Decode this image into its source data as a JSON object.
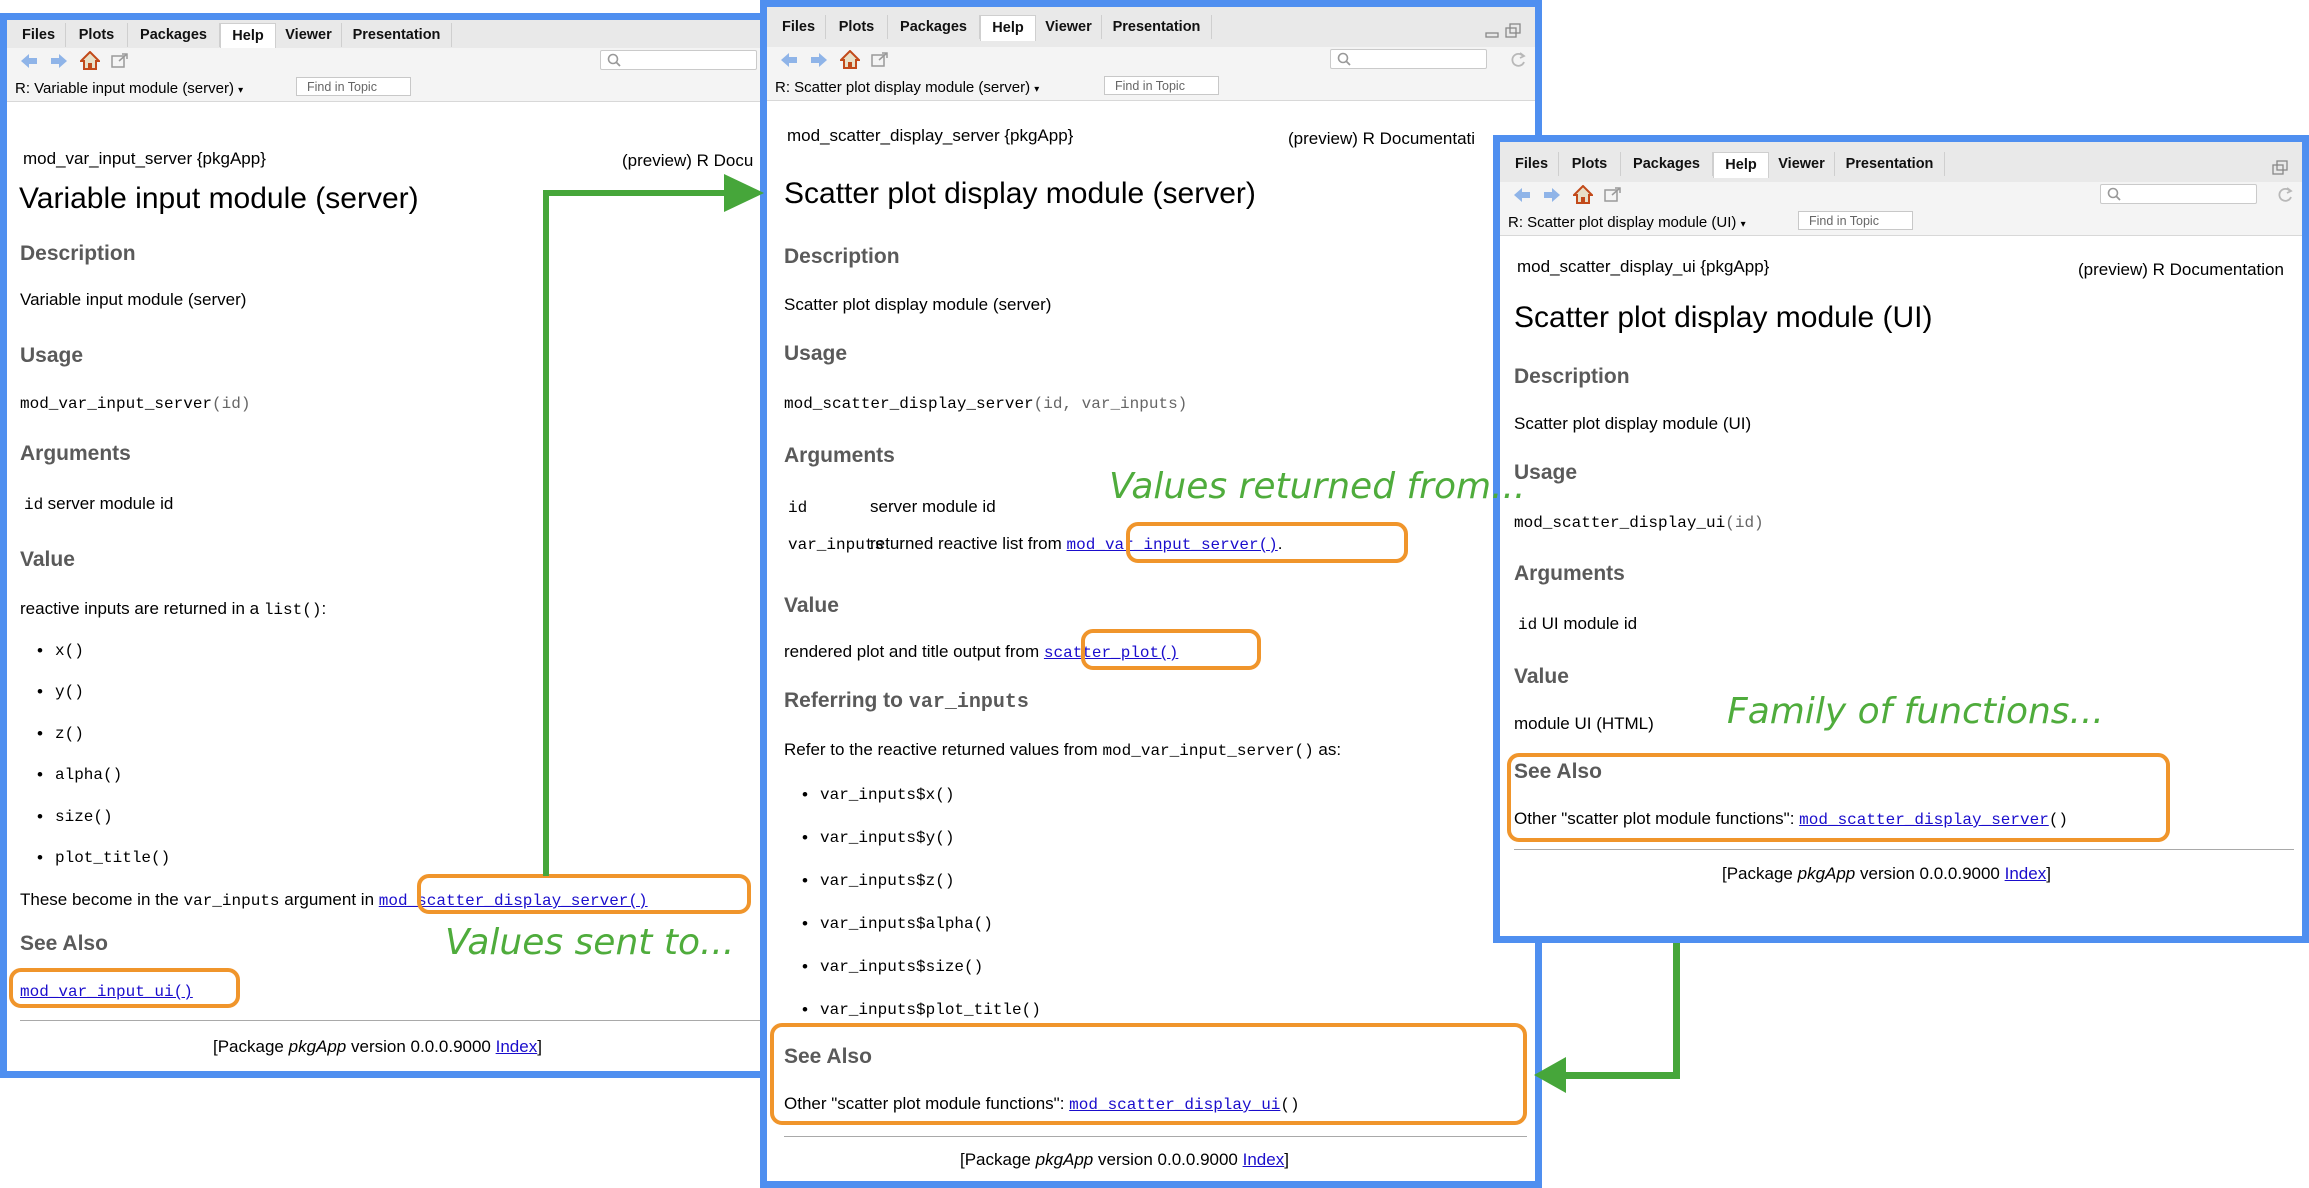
{
  "tabs": {
    "files": "Files",
    "plots": "Plots",
    "packages": "Packages",
    "help": "Help",
    "viewer": "Viewer",
    "presentation": "Presentation"
  },
  "find_placeholder": "Find in Topic",
  "windows": {
    "w1": {
      "address": "R: Variable input module (server)",
      "pkg_line": "mod_var_input_server {pkgApp}",
      "doc_type": "(preview) R Docu",
      "title": "Variable input module (server)",
      "description_heading": "Description",
      "description": "Variable input module (server)",
      "usage_heading": "Usage",
      "usage_fn": "mod_var_input_server",
      "usage_args": "(id)",
      "arguments_heading": "Arguments",
      "arg_name": "id",
      "arg_desc": "server module id",
      "value_heading": "Value",
      "value_text": "reactive inputs are returned in a",
      "value_code": "list()",
      "value_colon": ":",
      "items": [
        "x()",
        "y()",
        "z()",
        "alpha()",
        "size()",
        "plot_title()"
      ],
      "become_text": "These become in the",
      "become_code": "var_inputs",
      "become_text2": "argument in",
      "become_link": "mod_scatter_display_server()",
      "see_also_heading": "See Also",
      "see_also_link": "mod_var_input_ui()",
      "footer_pre": "[Package ",
      "footer_pkg": "pkgApp",
      "footer_ver": " version 0.0.0.9000 ",
      "footer_index": "Index",
      "footer_post": "]"
    },
    "w2": {
      "address": "R: Scatter plot display module (server)",
      "pkg_line": "mod_scatter_display_server {pkgApp}",
      "doc_type": "(preview) R Documentati",
      "title": "Scatter plot display module (server)",
      "description_heading": "Description",
      "description": "Scatter plot display module (server)",
      "usage_heading": "Usage",
      "usage_fn": "mod_scatter_display_server",
      "usage_args": "(id, var_inputs)",
      "arguments_heading": "Arguments",
      "arg1_name": "id",
      "arg1_desc": "server module id",
      "arg2_name": "var_inputs",
      "arg2_desc": "returned reactive list from",
      "arg2_link": "mod_var_input_server()",
      "arg2_post": ".",
      "value_heading": "Value",
      "value_text": "rendered plot and title output from",
      "value_link": "scatter_plot()",
      "referring_heading": "Referring to",
      "referring_code": "var_inputs",
      "refer_text": "Refer to the reactive returned values from",
      "refer_code": "mod_var_input_server()",
      "refer_as": "as:",
      "items": [
        "var_inputs$x()",
        "var_inputs$y()",
        "var_inputs$z()",
        "var_inputs$alpha()",
        "var_inputs$size()",
        "var_inputs$plot_title()"
      ],
      "see_also_heading": "See Also",
      "see_also_text": "Other \"scatter plot module functions\":",
      "see_also_link": "mod_scatter_display_ui",
      "see_also_parens": "()",
      "footer_pre": "[Package ",
      "footer_pkg": "pkgApp",
      "footer_ver": " version 0.0.0.9000 ",
      "footer_index": "Index",
      "footer_post": "]"
    },
    "w3": {
      "address": "R: Scatter plot display module (UI)",
      "pkg_line": "mod_scatter_display_ui {pkgApp}",
      "doc_type": "(preview) R Documentation",
      "title": "Scatter plot display module (UI)",
      "description_heading": "Description",
      "description": "Scatter plot display module (UI)",
      "usage_heading": "Usage",
      "usage_fn": "mod_scatter_display_ui",
      "usage_args": "(id)",
      "arguments_heading": "Arguments",
      "arg_name": "id",
      "arg_desc": "UI module id",
      "value_heading": "Value",
      "value_text": "module UI (HTML)",
      "see_also_heading": "See Also",
      "see_also_text": "Other \"scatter plot module functions\":",
      "see_also_link": "mod_scatter_display_server",
      "see_also_parens": "()",
      "footer_pre": "[Package ",
      "footer_pkg": "pkgApp",
      "footer_ver": " version 0.0.0.9000 ",
      "footer_index": "Index",
      "footer_post": "]"
    }
  },
  "annotations": {
    "values_returned_from": "Values returned from...",
    "values_sent_to": "Values sent to...",
    "family_of_functions": "Family of functions..."
  },
  "colors": {
    "window_border": "#4f8ff0",
    "highlight": "#f0952b",
    "arrow": "#46a63a",
    "link": "#1a0dcc"
  }
}
